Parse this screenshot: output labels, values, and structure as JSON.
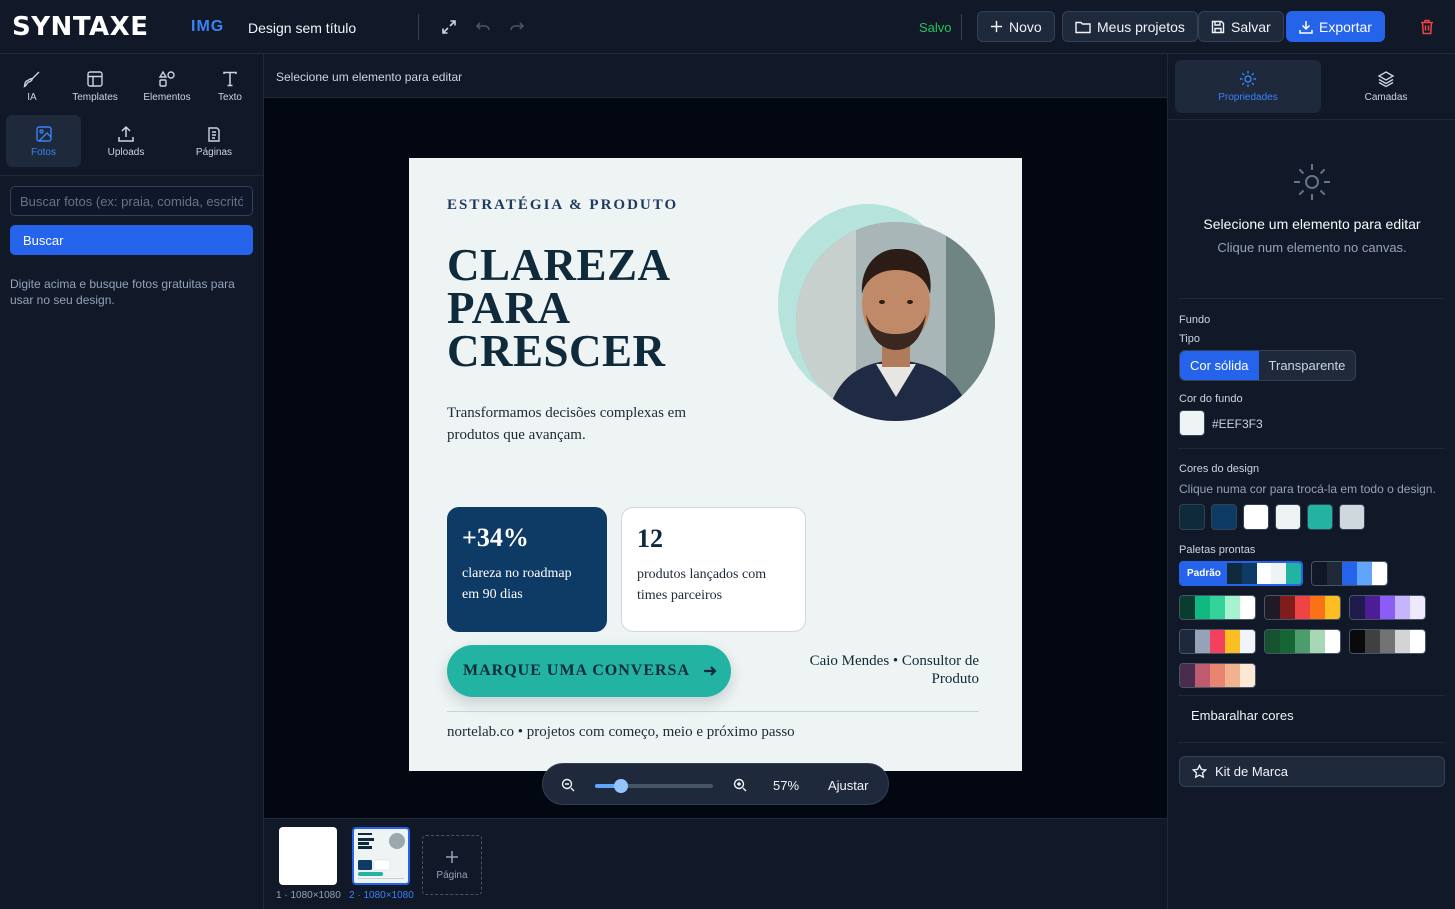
{
  "header": {
    "logo": "SYNTAXE",
    "logo_badge": "IMG",
    "doc_title": "Design sem título",
    "status": "Salvo",
    "buttons": {
      "new": "Novo",
      "projects": "Meus projetos",
      "save": "Salvar",
      "export": "Exportar"
    }
  },
  "leftbar": {
    "tools": [
      "IA",
      "Templates",
      "Elementos",
      "Texto",
      "Fotos",
      "Uploads",
      "Páginas"
    ],
    "search_placeholder": "Buscar fotos (ex: praia, comida, escritório)",
    "search_button": "Buscar",
    "hint": "Digite acima e busque fotos gratuitas para usar no seu design."
  },
  "center": {
    "hint": "Selecione um elemento para editar",
    "canvas": {
      "eyebrow": "ESTRATÉGIA & PRODUTO",
      "title_lines": [
        "CLAREZA",
        "PARA",
        "CRESCER"
      ],
      "subtitle": "Transformamos decisões complexas em produtos que avançam.",
      "stats": [
        {
          "value": "+34%",
          "label": "clareza no roadmap em 90 dias"
        },
        {
          "value": "12",
          "label": "produtos lançados com times parceiros"
        }
      ],
      "cta": "MARQUE UMA CONVERSA",
      "author": "Caio Mendes • Consultor de Produto",
      "footer": "nortelab.co • projetos com começo, meio e próximo passo"
    },
    "zoom": {
      "value": "57%",
      "level": 0.57,
      "fit": "Ajustar"
    },
    "pages": [
      {
        "label": "1 · 1080×1080"
      },
      {
        "label": "2 · 1080×1080"
      }
    ],
    "add_page": "Página"
  },
  "rightbar": {
    "tabs": [
      "Propriedades",
      "Camadas"
    ],
    "empty_title": "Selecione um elemento para editar",
    "empty_sub": "Clique num elemento no canvas.",
    "background": {
      "section": "Fundo",
      "type_label": "Tipo",
      "types": [
        "Cor sólida",
        "Transparente"
      ],
      "color_label": "Cor do fundo",
      "color": "#EEF3F3",
      "color_text": "#EEF3F3"
    },
    "design_colors": {
      "title": "Cores do design",
      "hint": "Clique numa cor para trocá-la em todo o design.",
      "colors": [
        "#0f2a3a",
        "#0e3a66",
        "#ffffff",
        "#eef3f3",
        "#22b3a3",
        "#cfd8dc"
      ]
    },
    "palettes": {
      "title": "Paletas prontas",
      "default_tag": "Padrão",
      "list": [
        [
          "#0f2a3a",
          "#0e3a66",
          "#ffffff",
          "#eef3f3",
          "#22b3a3"
        ],
        [
          "#111827",
          "#1f2937",
          "#2563eb",
          "#60a5fa",
          "#ffffff"
        ],
        [
          "#0b3d2e",
          "#10b981",
          "#34d399",
          "#a7f3d0",
          "#ffffff"
        ],
        [
          "#1f1a24",
          "#7f1d1d",
          "#ef4444",
          "#f97316",
          "#fbbf24"
        ],
        [
          "#1e1b4b",
          "#4c1d95",
          "#8b5cf6",
          "#c4b5fd",
          "#ede9fe"
        ],
        [
          "#1e293b",
          "#94a3b8",
          "#f43f5e",
          "#fbbf24",
          "#f1f5f9"
        ],
        [
          "#14532d",
          "#166534",
          "#4d9d6c",
          "#a7d7b5",
          "#ffffff"
        ],
        [
          "#0a0a0a",
          "#404040",
          "#737373",
          "#d4d4d4",
          "#ffffff"
        ],
        [
          "#4a2c4d",
          "#c05a6e",
          "#e8846f",
          "#f1b38e",
          "#fde8d6"
        ]
      ]
    },
    "shuffle": "Embaralhar cores",
    "brand_kit": "Kit de Marca"
  }
}
